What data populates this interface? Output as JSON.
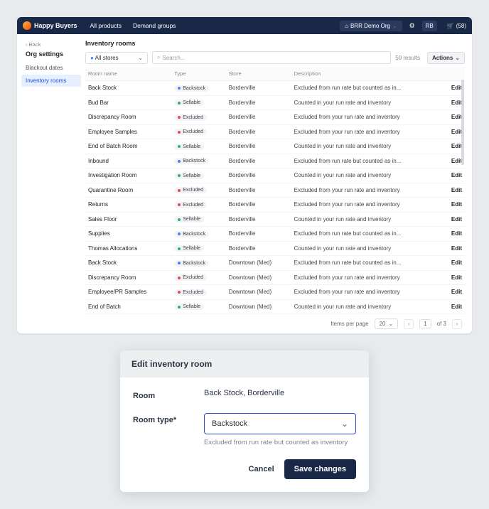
{
  "header": {
    "brand": "Happy Buyers",
    "nav": [
      "All products",
      "Demand groups"
    ],
    "org": "BRR Demo Org",
    "user_initials": "RB",
    "cart_count_label": "(58)"
  },
  "sidebar": {
    "back_label": "Back",
    "heading": "Org settings",
    "items": [
      {
        "label": "Blackout dates",
        "active": false
      },
      {
        "label": "Inventory rooms",
        "active": true
      }
    ]
  },
  "page": {
    "title": "Inventory rooms",
    "store_filter": "All stores",
    "search_placeholder": "Search...",
    "results_label": "50 results",
    "actions_label": "Actions",
    "columns": [
      "Room name",
      "Type",
      "Store",
      "Description",
      ""
    ],
    "edit_label": "Edit",
    "rows": [
      {
        "name": "Back Stock",
        "type": "Backstock",
        "type_color": "blue",
        "store": "Borderville",
        "desc": "Excluded from run rate but counted as in..."
      },
      {
        "name": "Bud Bar",
        "type": "Sellable",
        "type_color": "green",
        "store": "Borderville",
        "desc": "Counted in your run rate and inventory"
      },
      {
        "name": "Discrepancy Room",
        "type": "Excluded",
        "type_color": "red",
        "store": "Borderville",
        "desc": "Excluded from your run rate and inventory"
      },
      {
        "name": "Employee Samples",
        "type": "Excluded",
        "type_color": "red",
        "store": "Borderville",
        "desc": "Excluded from your run rate and inventory"
      },
      {
        "name": "End of Batch Room",
        "type": "Sellable",
        "type_color": "green",
        "store": "Borderville",
        "desc": "Counted in your run rate and inventory"
      },
      {
        "name": "Inbound",
        "type": "Backstock",
        "type_color": "blue",
        "store": "Borderville",
        "desc": "Excluded from run rate but counted as in..."
      },
      {
        "name": "Investigation Room",
        "type": "Sellable",
        "type_color": "green",
        "store": "Borderville",
        "desc": "Counted in your run rate and inventory"
      },
      {
        "name": "Quarantine Room",
        "type": "Excluded",
        "type_color": "red",
        "store": "Borderville",
        "desc": "Excluded from your run rate and inventory"
      },
      {
        "name": "Returns",
        "type": "Excluded",
        "type_color": "red",
        "store": "Borderville",
        "desc": "Excluded from your run rate and inventory"
      },
      {
        "name": "Sales Floor",
        "type": "Sellable",
        "type_color": "green",
        "store": "Borderville",
        "desc": "Counted in your run rate and inventory"
      },
      {
        "name": "Supplies",
        "type": "Backstock",
        "type_color": "blue",
        "store": "Borderville",
        "desc": "Excluded from run rate but counted as in..."
      },
      {
        "name": "Thomas Allocations",
        "type": "Sellable",
        "type_color": "green",
        "store": "Borderville",
        "desc": "Counted in your run rate and inventory"
      },
      {
        "name": "Back Stock",
        "type": "Backstock",
        "type_color": "blue",
        "store": "Downtown (Med)",
        "desc": "Excluded from run rate but counted as in..."
      },
      {
        "name": "Discrepancy Room",
        "type": "Excluded",
        "type_color": "red",
        "store": "Downtown (Med)",
        "desc": "Excluded from your run rate and inventory"
      },
      {
        "name": "Employee/PR Samples",
        "type": "Excluded",
        "type_color": "red",
        "store": "Downtown (Med)",
        "desc": "Excluded from your run rate and inventory"
      },
      {
        "name": "End of Batch",
        "type": "Sellable",
        "type_color": "green",
        "store": "Downtown (Med)",
        "desc": "Counted in your run rate and inventory"
      }
    ],
    "pager": {
      "items_per_page_label": "Items per page",
      "items_per_page_value": "20",
      "current_page": "1",
      "total_pages_label": "of 3"
    }
  },
  "modal": {
    "title": "Edit inventory room",
    "room_label": "Room",
    "room_value": "Back Stock, Borderville",
    "type_label": "Room type*",
    "type_value": "Backstock",
    "type_help": "Excluded from run rate but counted as inventory",
    "cancel_label": "Cancel",
    "save_label": "Save changes"
  }
}
